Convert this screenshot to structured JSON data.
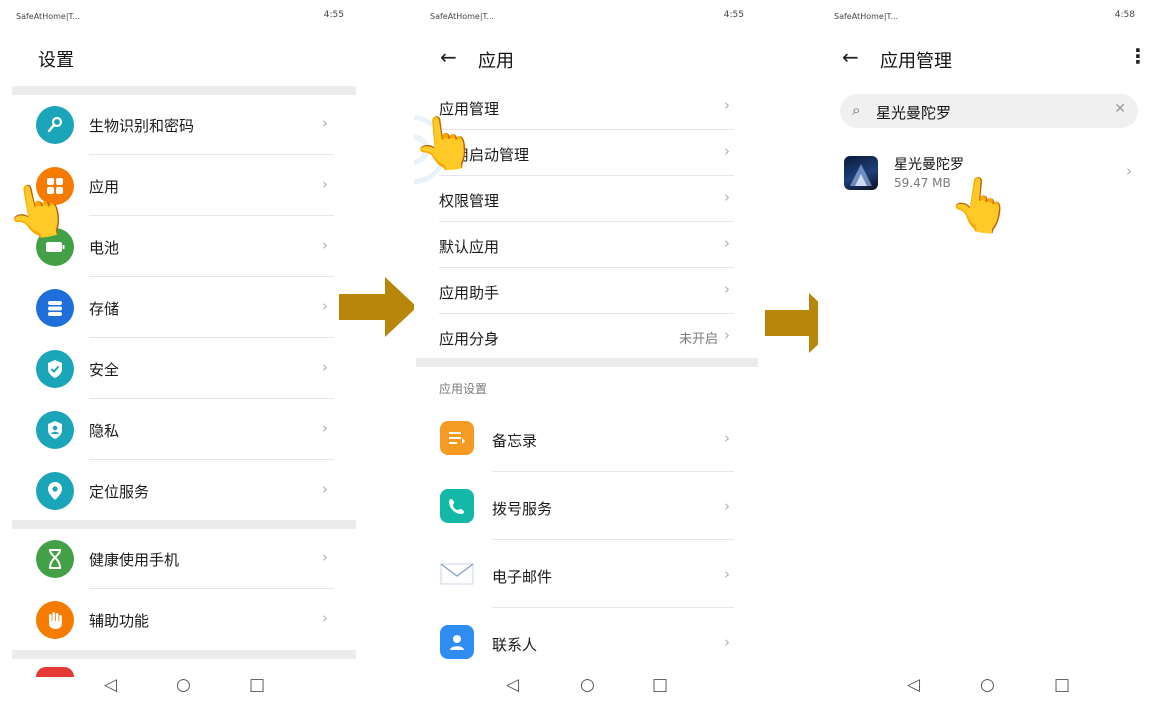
{
  "panel1": {
    "status": {
      "carrier": "SafeAtHome|T...",
      "right": "4:55"
    },
    "title": "设置",
    "items": [
      {
        "label": "生物识别和密码",
        "icon": "key-icon",
        "color": "#1aa5b8"
      },
      {
        "label": "应用",
        "icon": "apps-icon",
        "color": "#f57c00"
      },
      {
        "label": "电池",
        "icon": "battery-icon",
        "color": "#43a047"
      },
      {
        "label": "存储",
        "icon": "storage-icon",
        "color": "#1e6fd9"
      },
      {
        "label": "安全",
        "icon": "shield-icon",
        "color": "#1aa5b8"
      },
      {
        "label": "隐私",
        "icon": "privacy-icon",
        "color": "#1aa5b8"
      },
      {
        "label": "定位服务",
        "icon": "location-icon",
        "color": "#1aa5b8"
      },
      {
        "label": "健康使用手机",
        "icon": "hourglass-icon",
        "color": "#43a047"
      },
      {
        "label": "辅助功能",
        "icon": "hand-icon",
        "color": "#f57c00"
      }
    ]
  },
  "panel2": {
    "status": {
      "carrier": "SafeAtHome|T...",
      "right": "4:55"
    },
    "title": "应用",
    "items": [
      {
        "label": "应用管理"
      },
      {
        "label": "应用启动管理"
      },
      {
        "label": "权限管理"
      },
      {
        "label": "默认应用"
      },
      {
        "label": "应用助手"
      },
      {
        "label": "应用分身",
        "value": "未开启"
      }
    ],
    "section_header": "应用设置",
    "app_items": [
      {
        "label": "备忘录",
        "icon": "notepad-icon",
        "color": "#f59a23"
      },
      {
        "label": "拨号服务",
        "icon": "phone-icon",
        "color": "#14b8a6"
      },
      {
        "label": "电子邮件",
        "icon": "mail-icon",
        "color": "#8aa0c8"
      },
      {
        "label": "联系人",
        "icon": "contacts-icon",
        "color": "#2f8cf0"
      }
    ]
  },
  "panel3": {
    "status": {
      "carrier": "SafeAtHome|T...",
      "right": "4:58"
    },
    "title": "应用管理",
    "search_value": "星光曼陀罗",
    "result": {
      "name": "星光曼陀罗",
      "size": "59.47 MB"
    }
  },
  "colors": {
    "arrow": "#b8860b",
    "divider": "#e6e6e6"
  }
}
